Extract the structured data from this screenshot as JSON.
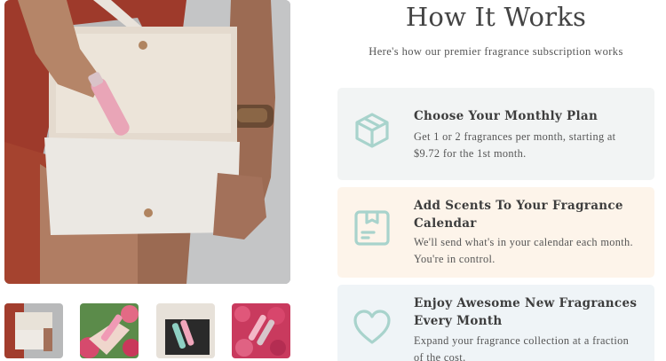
{
  "section": {
    "title": "How It Works",
    "subtitle": "Here's how our premier fragrance subscription works"
  },
  "steps": [
    {
      "icon": "box-icon",
      "title": "Choose Your Monthly Plan",
      "description": "Get 1 or 2 fragrances per month, starting at $9.72 for the 1st month."
    },
    {
      "icon": "calendar-icon",
      "title": "Add Scents To Your Fragrance Calendar",
      "description": "We'll send what's in your calendar each month. You're in control."
    },
    {
      "icon": "heart-icon",
      "title": "Enjoy Awesome New Fragrances Every Month",
      "description": "Expand your fragrance collection at a fraction of the cost."
    }
  ],
  "gallery": {
    "thumbnails": [
      "bag-with-atomizer",
      "atomizer-in-hand-with-flowers",
      "atomizers-in-gift-box",
      "atomizers-on-roses"
    ]
  },
  "colors": {
    "icon_teal": "#a8d3cc",
    "step1_bg": "#f2f4f4",
    "step2_bg": "#fdf4ea",
    "step3_bg": "#eff4f7"
  }
}
